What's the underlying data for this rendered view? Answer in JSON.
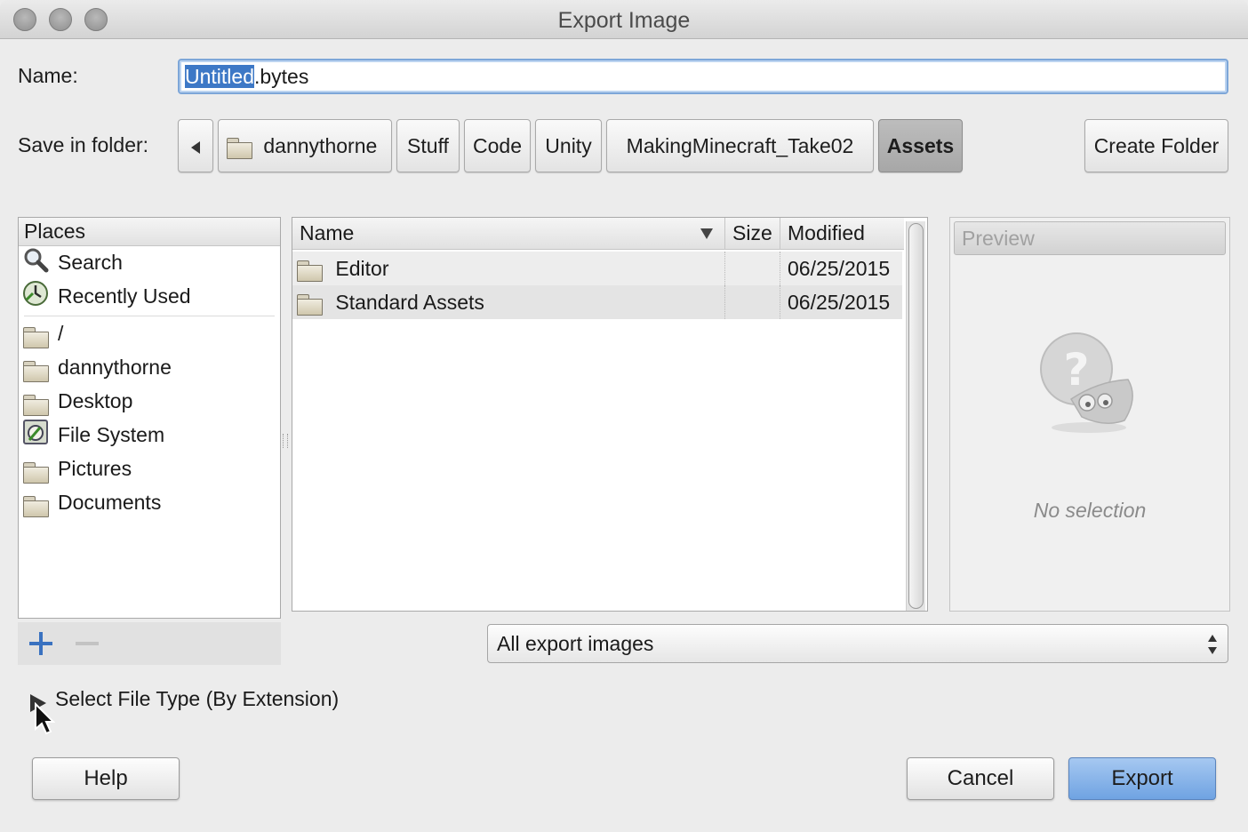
{
  "window": {
    "title": "Export Image"
  },
  "name_row": {
    "label": "Name:",
    "value_selected": "Untitled",
    "value_rest": ".bytes"
  },
  "folder_row": {
    "label": "Save in folder:",
    "crumbs": [
      "dannythorne",
      "Stuff",
      "Code",
      "Unity",
      "MakingMinecraft_Take02",
      "Assets"
    ],
    "create_folder": "Create Folder"
  },
  "places": {
    "header": "Places",
    "items": [
      "Search",
      "Recently Used",
      "/",
      "dannythorne",
      "Desktop",
      "File System",
      "Pictures",
      "Documents"
    ]
  },
  "files": {
    "columns": {
      "name": "Name",
      "size": "Size",
      "modified": "Modified"
    },
    "rows": [
      {
        "name": "Editor",
        "size": "",
        "modified": "06/25/2015"
      },
      {
        "name": "Standard Assets",
        "size": "",
        "modified": "06/25/2015"
      }
    ]
  },
  "preview": {
    "header": "Preview",
    "empty_text": "No selection"
  },
  "filter": {
    "selected": "All export images"
  },
  "file_type_expander": "Select File Type (By Extension)",
  "buttons": {
    "help": "Help",
    "cancel": "Cancel",
    "export": "Export"
  },
  "colors": {
    "accent": "#6fa3e2",
    "selection": "#3d78c6"
  }
}
